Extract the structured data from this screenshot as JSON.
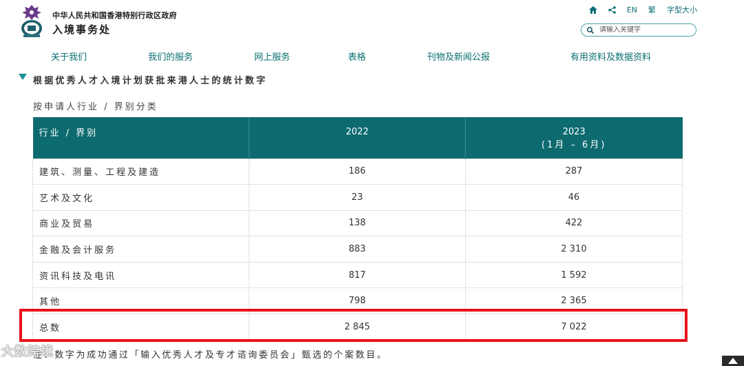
{
  "header": {
    "government_name": "中华人民共和国香港特别行政区政府",
    "department_name": "入境事务处",
    "tools": {
      "language_en": "EN",
      "language_traditional": "繁",
      "font_size": "字型大小"
    },
    "search": {
      "placeholder": "请输入关键字"
    }
  },
  "nav": {
    "items": [
      {
        "label": "关于我们"
      },
      {
        "label": "我们的服务"
      },
      {
        "label": "网上服务"
      },
      {
        "label": "表格"
      },
      {
        "label": "刊物及新闻公报"
      },
      {
        "label": "有用资料及数据资料"
      }
    ]
  },
  "section": {
    "title": "根据优秀人才入境计划获批来港人士的统计数字",
    "subtitle": "按申请人行业 / 界别分类"
  },
  "table": {
    "headers": {
      "category": "行业 / 界别",
      "col1": "2022",
      "col2_year": "2023",
      "col2_period": "(1月 – 6月)"
    },
    "rows": [
      {
        "category": "建筑、测量、工程及建造",
        "v2022": "186",
        "v2023": "287"
      },
      {
        "category": "艺术及文化",
        "v2022": "23",
        "v2023": "46"
      },
      {
        "category": "商业及贸易",
        "v2022": "138",
        "v2023": "422"
      },
      {
        "category": "金融及会计服务",
        "v2022": "883",
        "v2023": "2 310"
      },
      {
        "category": "资讯科技及电讯",
        "v2022": "817",
        "v2023": "1 592"
      },
      {
        "category": "其他",
        "v2022": "798",
        "v2023": "2 365"
      }
    ],
    "total": {
      "category": "总数",
      "v2022": "2 845",
      "v2023": "7 022"
    }
  },
  "note": "注：数字为成功通过「输入优秀人才及专才谘询委员会」甄选的个案数目。",
  "watermark": "大数跨境",
  "colors": {
    "accent": "#0d6b70",
    "nav_text": "#0a6e72",
    "highlight": "#e8101b"
  }
}
